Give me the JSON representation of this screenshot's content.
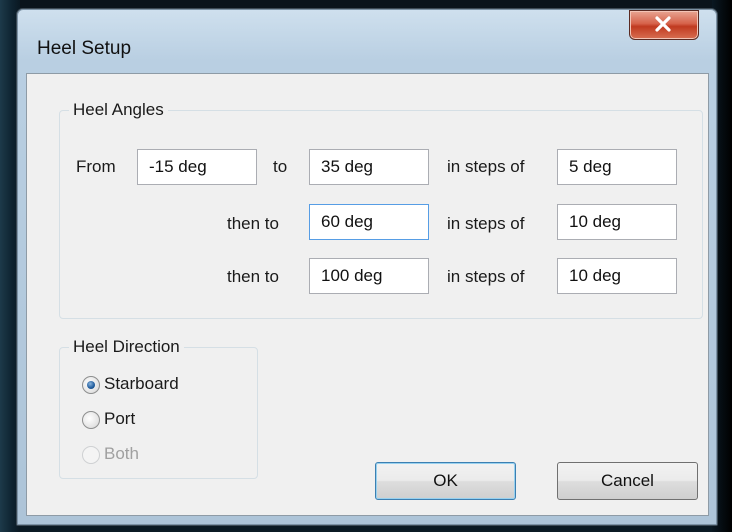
{
  "window": {
    "title": "Heel Setup"
  },
  "heel_angles": {
    "title": "Heel Angles",
    "rows": [
      {
        "prefix": "From",
        "start": "-15 deg",
        "to_label": "to",
        "end": "35 deg",
        "steps_label": "in steps of",
        "step": "5 deg"
      },
      {
        "prefix": "then to",
        "end": "60 deg",
        "steps_label": "in steps of",
        "step": "10 deg"
      },
      {
        "prefix": "then to",
        "end": "100 deg",
        "steps_label": "in steps of",
        "step": "10 deg"
      }
    ]
  },
  "heel_direction": {
    "title": "Heel Direction",
    "options": [
      {
        "label": "Starboard",
        "selected": true,
        "enabled": true
      },
      {
        "label": "Port",
        "selected": false,
        "enabled": true
      },
      {
        "label": "Both",
        "selected": false,
        "enabled": false
      }
    ]
  },
  "buttons": {
    "ok": "OK",
    "cancel": "Cancel"
  },
  "icons": {
    "close": "close-icon"
  },
  "colors": {
    "title_bar": "#b9cfe2",
    "close_button": "#c8452a",
    "focus_border": "#569de5"
  }
}
